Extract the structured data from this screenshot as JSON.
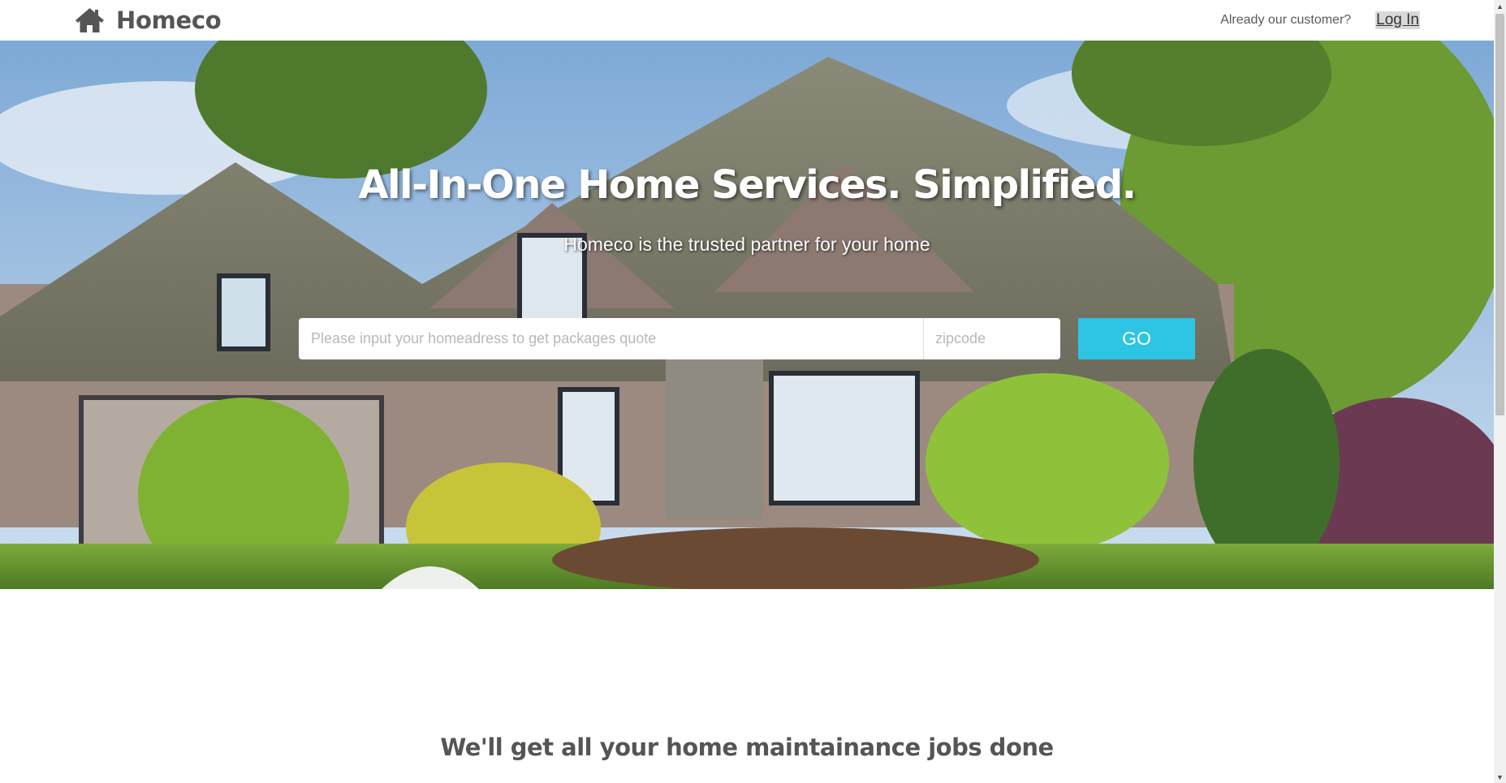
{
  "header": {
    "brand_name": "Homeco",
    "customer_text": "Already our customer?",
    "login_label": "Log In"
  },
  "hero": {
    "title": "All-In-One Home Services. Simplified.",
    "subtitle": "Homeco is the trusted partner for your home",
    "address_placeholder": "Please input your homeadress to get packages quote",
    "address_value": "",
    "zip_placeholder": "zipcode",
    "zip_value": "",
    "go_label": "GO",
    "background_image": "house-with-garden-photo"
  },
  "section": {
    "title": "We'll get all your home maintainance jobs done"
  },
  "colors": {
    "accent": "#2ec4e4",
    "text": "#555555",
    "header_bg": "#ffffff"
  }
}
